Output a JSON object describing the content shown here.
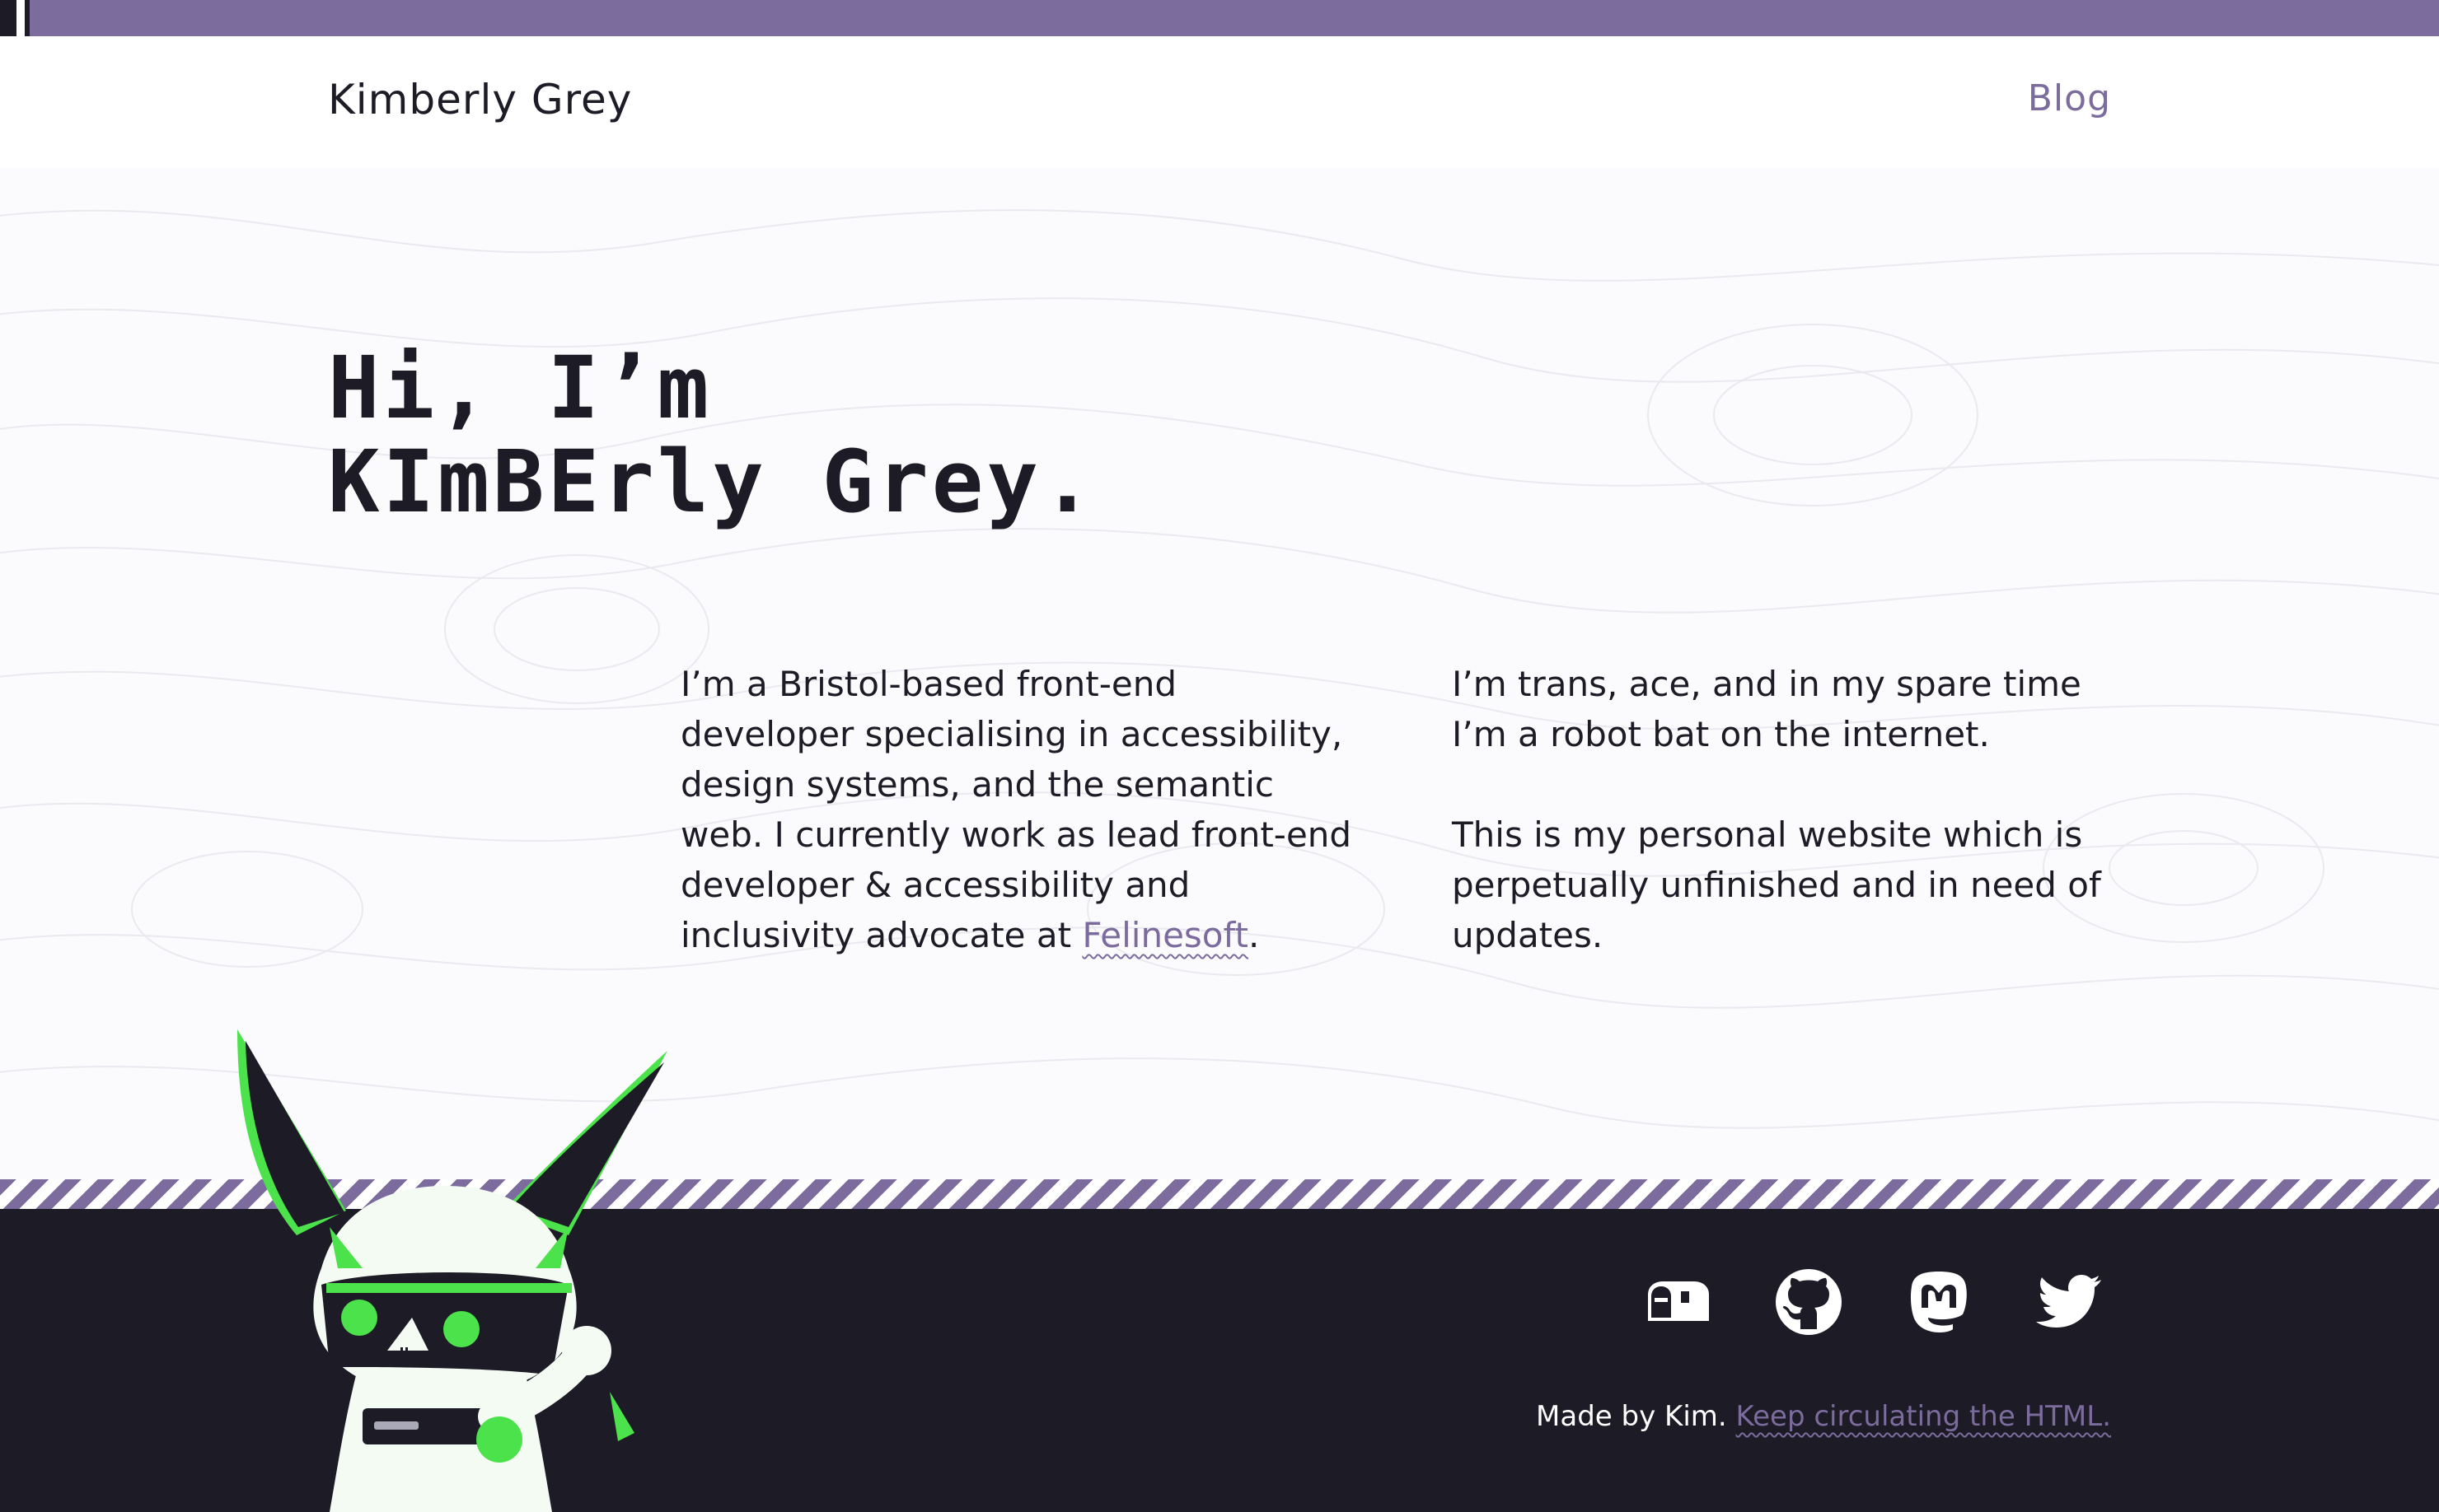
{
  "header": {
    "site_name": "Kimberly Grey",
    "nav": {
      "blog_label": "Blog"
    }
  },
  "hero": {
    "greeting": "Hi, I’m",
    "name": "KImBErly Grey."
  },
  "bio": {
    "left_text": "I’m a Bristol-based front-end developer specialising in accessibility, design systems, and the semantic web. I currently work as lead front-end developer & accessibility and inclusivity advocate at ",
    "left_link": "Felinesoft",
    "left_suffix": ".",
    "right_para1": "I’m trans, ace, and in my spare time I’m a robot bat on the internet.",
    "right_para2": "This is my personal website which is perpetually unfinished and in need of updates."
  },
  "footer": {
    "social_icons": [
      "mailbox-icon",
      "github-icon",
      "mastodon-icon",
      "twitter-icon"
    ],
    "credit_text": "Made by Kim.",
    "credit_link": "Keep circulating the HTML."
  },
  "colors": {
    "accent": "#7b6c9d",
    "dark": "#1d1b26",
    "mascot_green": "#4ce24c"
  }
}
